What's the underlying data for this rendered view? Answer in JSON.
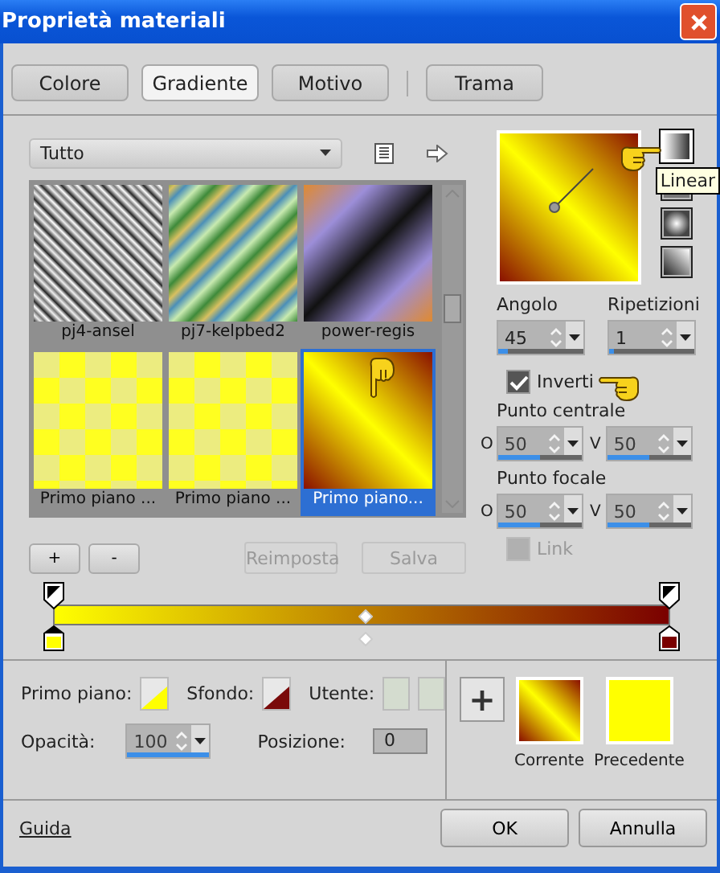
{
  "window": {
    "title": "Proprietà materiali"
  },
  "tabs": [
    {
      "label": "Colore",
      "selected": false
    },
    {
      "label": "Gradiente",
      "selected": true
    },
    {
      "label": "Motivo",
      "selected": false
    },
    {
      "label": "Trama",
      "selected": false
    }
  ],
  "category": {
    "value": "Tutto"
  },
  "gradients": [
    {
      "label": "pj4-ansel",
      "kind": "silver",
      "selected": false
    },
    {
      "label": "pj7-kelpbed2",
      "kind": "kelp",
      "selected": false
    },
    {
      "label": "power-regis",
      "kind": "dusk",
      "selected": false
    },
    {
      "label": "Primo piano ...",
      "kind": "checker",
      "selected": false
    },
    {
      "label": "Primo piano ...",
      "kind": "checker",
      "selected": false
    },
    {
      "label": "Primo piano...",
      "kind": "fire",
      "selected": true
    }
  ],
  "styles": [
    {
      "kind": "linear",
      "selected": true
    },
    {
      "kind": "rectangular",
      "selected": false
    },
    {
      "kind": "radial",
      "selected": false
    },
    {
      "kind": "sunburst",
      "selected": false
    }
  ],
  "tooltip": "Linear",
  "angle": {
    "label": "Angolo",
    "value": "45",
    "level": 0.12
  },
  "repeats": {
    "label": "Ripetizioni",
    "value": "1",
    "level": 0.06
  },
  "invert": {
    "label": "Inverti",
    "checked": true
  },
  "center": {
    "label": "Punto centrale",
    "fields": [
      {
        "axis": "O",
        "value": "50",
        "level": 0.5
      },
      {
        "axis": "V",
        "value": "50",
        "level": 0.5
      }
    ]
  },
  "focal": {
    "label": "Punto focale",
    "fields": [
      {
        "axis": "O",
        "value": "50",
        "level": 0.5
      },
      {
        "axis": "V",
        "value": "50",
        "level": 0.5
      }
    ]
  },
  "link": {
    "label": "Link",
    "checked": false,
    "disabled": true
  },
  "stop_buttons": [
    "+",
    "-"
  ],
  "actions": [
    {
      "label": "Reimposta",
      "disabled": true
    },
    {
      "label": "Salva",
      "disabled": true
    }
  ],
  "stops": [
    {
      "color": "#ffff00",
      "selected": true
    },
    {
      "color": "#7a0000",
      "selected": false
    }
  ],
  "foreground": {
    "label": "Primo piano:",
    "color": "#ffff00"
  },
  "background": {
    "label": "Sfondo:",
    "color": "#7a0a0a"
  },
  "user": {
    "label": "Utente:"
  },
  "opacity": {
    "label": "Opacità:",
    "value": "100",
    "level": 1
  },
  "position": {
    "label": "Posizione:",
    "value": "0"
  },
  "add_button": "+",
  "current": {
    "label": "Corrente"
  },
  "previous": {
    "label": "Precedente"
  },
  "footer": {
    "help": "Guida",
    "buttons": [
      "OK",
      "Annulla"
    ]
  }
}
